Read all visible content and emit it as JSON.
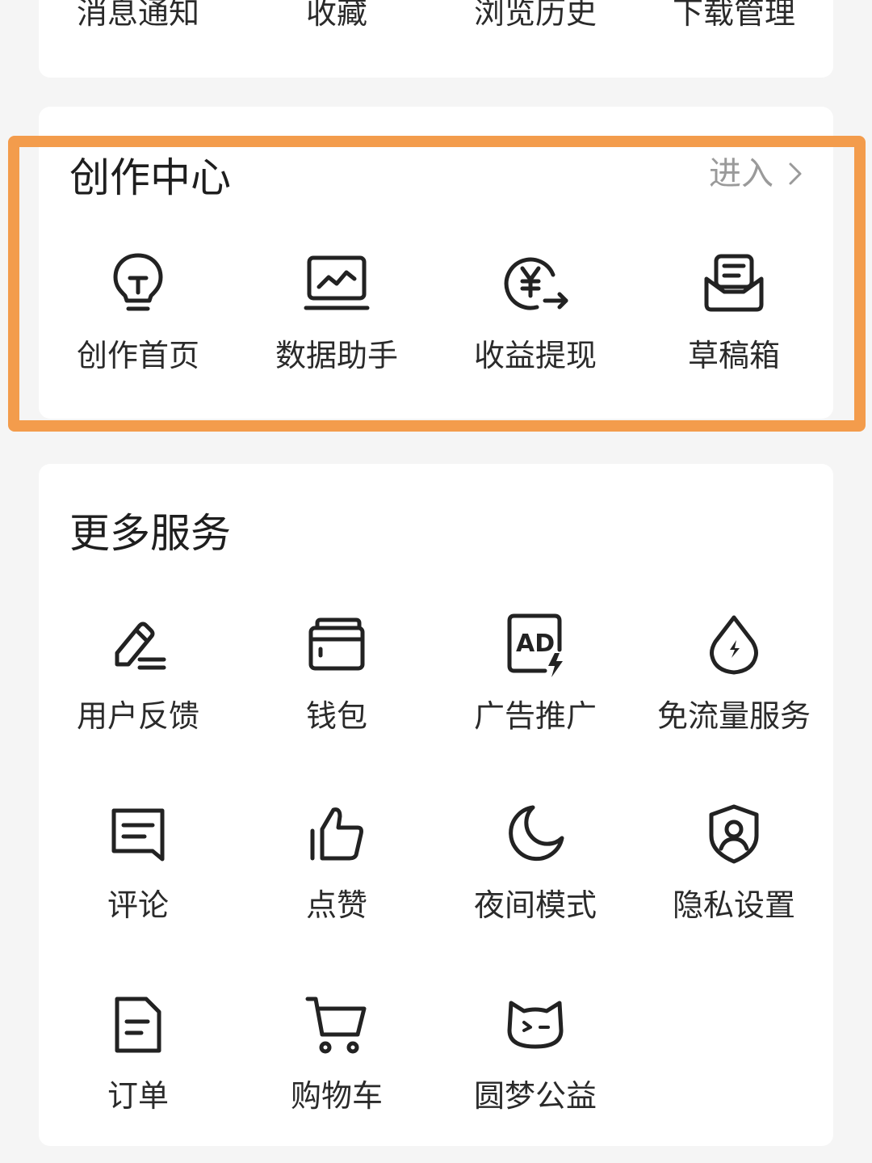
{
  "top_row": {
    "items": [
      {
        "label": "消息通知",
        "icon": "bell-icon"
      },
      {
        "label": "收藏",
        "icon": "star-icon"
      },
      {
        "label": "浏览历史",
        "icon": "history-icon"
      },
      {
        "label": "下载管理",
        "icon": "download-icon"
      }
    ]
  },
  "create_center": {
    "title": "创作中心",
    "enter_label": "进入",
    "items": [
      {
        "label": "创作首页",
        "icon": "lightbulb-icon"
      },
      {
        "label": "数据助手",
        "icon": "chart-monitor-icon"
      },
      {
        "label": "收益提现",
        "icon": "yuan-withdraw-icon"
      },
      {
        "label": "草稿箱",
        "icon": "draft-box-icon"
      }
    ]
  },
  "more_services": {
    "title": "更多服务",
    "items": [
      {
        "label": "用户反馈",
        "icon": "pencil-icon"
      },
      {
        "label": "钱包",
        "icon": "wallet-icon"
      },
      {
        "label": "广告推广",
        "icon": "ad-icon"
      },
      {
        "label": "免流量服务",
        "icon": "droplet-icon"
      },
      {
        "label": "评论",
        "icon": "comment-icon"
      },
      {
        "label": "点赞",
        "icon": "thumbs-up-icon"
      },
      {
        "label": "夜间模式",
        "icon": "moon-icon"
      },
      {
        "label": "隐私设置",
        "icon": "shield-user-icon"
      },
      {
        "label": "订单",
        "icon": "document-icon"
      },
      {
        "label": "购物车",
        "icon": "cart-icon"
      },
      {
        "label": "圆梦公益",
        "icon": "cat-face-icon"
      }
    ]
  },
  "colors": {
    "background": "#f5f5f5",
    "card": "#ffffff",
    "highlight": "#f39c4c",
    "text": "#2a2a2a",
    "muted": "#9a9a9a"
  }
}
